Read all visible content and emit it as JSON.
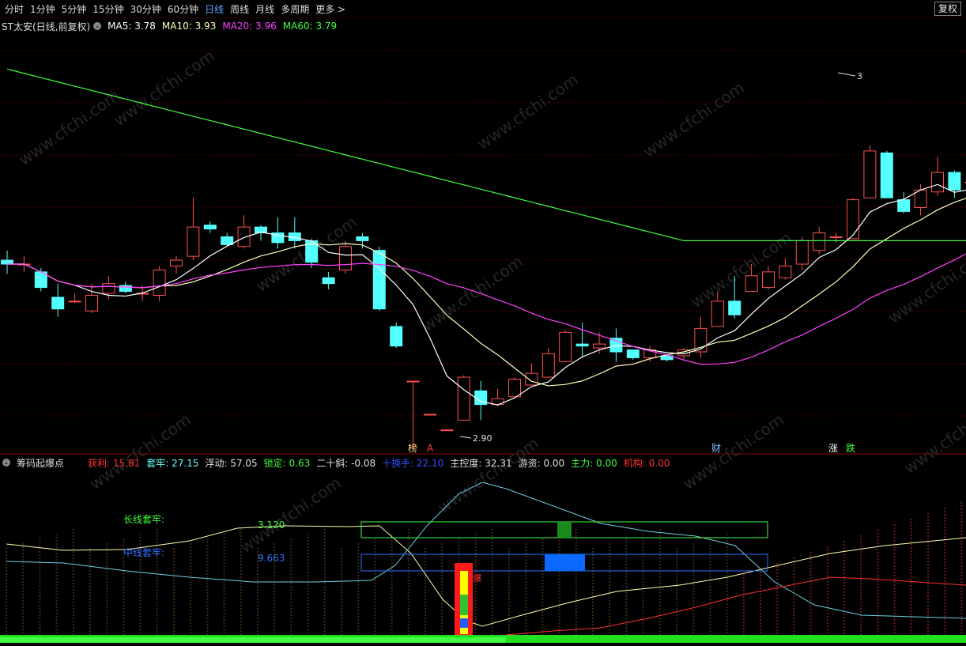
{
  "toolbar": {
    "periods": [
      "分时",
      "1分钟",
      "5分钟",
      "15分钟",
      "30分钟",
      "60分钟",
      "日线",
      "周线",
      "月线",
      "多周期",
      "更多 >"
    ],
    "active": "日线",
    "adjust": "复权"
  },
  "main_header": {
    "title": "ST太安(日线,前复权)",
    "ma5": "MA5: 3.78",
    "ma10": "MA10: 3.93",
    "ma20": "MA20: 3.96",
    "ma60": "MA60: 3.79",
    "colors": {
      "ma5": "#ffffff",
      "ma10": "#ffffc0",
      "ma20": "#ff40ff",
      "ma60": "#40ff40"
    }
  },
  "annotations": {
    "high_label": "3",
    "low_label": "2.90",
    "marks": [
      {
        "text": "榜",
        "color": "#ffd080"
      },
      {
        "text": "A",
        "color": "#ff4040"
      },
      {
        "text": "财",
        "color": "#80c0ff"
      },
      {
        "text": "涨",
        "color": "#ffffff"
      },
      {
        "text": "跌",
        "color": "#40ff40"
      }
    ]
  },
  "sub_header": {
    "title": "筹码起爆点",
    "items": [
      {
        "text": "获利: 15.81",
        "color": "#ff3030"
      },
      {
        "text": "套牢: 27.15",
        "color": "#66ffff"
      },
      {
        "text": "浮动: 57.05",
        "color": "#e0e0e0"
      },
      {
        "text": "锁定: 0.63",
        "color": "#40ff40"
      },
      {
        "text": "二十斜: -0.08",
        "color": "#e0e0e0"
      },
      {
        "text": "十换手: 22.10",
        "color": "#3050ff"
      },
      {
        "text": "主控度: 32.31",
        "color": "#e0e0e0"
      },
      {
        "text": "游资: 0.00",
        "color": "#e0e0e0"
      },
      {
        "text": "主力: 0.00",
        "color": "#40ff40"
      },
      {
        "text": "机构: 0.00",
        "color": "#ff3030"
      }
    ]
  },
  "indicator": {
    "long_label": "长线套牢:",
    "long_value": "3.120",
    "mid_label": "中线套牢:",
    "mid_value": "9.663",
    "burst_label": "爆"
  },
  "watermark": "www.cfchi.com",
  "chart_data": {
    "type": "candlestick",
    "ylim": [
      2.8,
      4.9
    ],
    "candles": [
      [
        3.72,
        3.7,
        3.77,
        3.65
      ],
      [
        3.7,
        3.7,
        3.74,
        3.66
      ],
      [
        3.66,
        3.58,
        3.68,
        3.56
      ],
      [
        3.53,
        3.47,
        3.6,
        3.43
      ],
      [
        3.51,
        3.51,
        3.55,
        3.5
      ],
      [
        3.46,
        3.54,
        3.6,
        3.45
      ],
      [
        3.55,
        3.6,
        3.64,
        3.52
      ],
      [
        3.59,
        3.56,
        3.61,
        3.55
      ],
      [
        3.55,
        3.55,
        3.59,
        3.51
      ],
      [
        3.54,
        3.67,
        3.69,
        3.51
      ],
      [
        3.69,
        3.72,
        3.74,
        3.65
      ],
      [
        3.74,
        3.89,
        4.04,
        3.72
      ],
      [
        3.9,
        3.88,
        3.92,
        3.86
      ],
      [
        3.84,
        3.8,
        3.86,
        3.79
      ],
      [
        3.79,
        3.89,
        3.95,
        3.78
      ],
      [
        3.89,
        3.86,
        3.9,
        3.82
      ],
      [
        3.86,
        3.81,
        3.94,
        3.78
      ],
      [
        3.86,
        3.82,
        3.94,
        3.78
      ],
      [
        3.82,
        3.71,
        3.83,
        3.68
      ],
      [
        3.63,
        3.6,
        3.66,
        3.57
      ],
      [
        3.67,
        3.79,
        3.82,
        3.65
      ],
      [
        3.84,
        3.82,
        3.86,
        3.78
      ],
      [
        3.77,
        3.47,
        3.79,
        3.46
      ],
      [
        3.38,
        3.28,
        3.4,
        3.27
      ],
      [
        3.1,
        3.1,
        3.1,
        2.75
      ],
      [
        2.93,
        2.93,
        2.93,
        2.93
      ],
      [
        2.85,
        2.85,
        2.85,
        2.85
      ],
      [
        2.9,
        3.12,
        3.13,
        2.9
      ],
      [
        3.05,
        2.98,
        3.1,
        2.9
      ],
      [
        2.98,
        3.01,
        3.06,
        2.97
      ],
      [
        3.02,
        3.11,
        3.12,
        3.02
      ],
      [
        3.08,
        3.14,
        3.19,
        3.08
      ],
      [
        3.12,
        3.24,
        3.27,
        3.12
      ],
      [
        3.2,
        3.35,
        3.36,
        3.2
      ],
      [
        3.29,
        3.28,
        3.4,
        3.22
      ],
      [
        3.27,
        3.29,
        3.35,
        3.24
      ],
      [
        3.32,
        3.25,
        3.37,
        3.2
      ],
      [
        3.26,
        3.22,
        3.26,
        3.21
      ],
      [
        3.22,
        3.26,
        3.28,
        3.2
      ],
      [
        3.23,
        3.21,
        3.24,
        3.2
      ],
      [
        3.23,
        3.26,
        3.27,
        3.21
      ],
      [
        3.25,
        3.37,
        3.43,
        3.22
      ],
      [
        3.38,
        3.51,
        3.56,
        3.38
      ],
      [
        3.51,
        3.44,
        3.64,
        3.42
      ],
      [
        3.56,
        3.64,
        3.7,
        3.56
      ],
      [
        3.58,
        3.66,
        3.69,
        3.57
      ],
      [
        3.63,
        3.69,
        3.73,
        3.62
      ],
      [
        3.7,
        3.82,
        3.84,
        3.67
      ],
      [
        3.77,
        3.86,
        3.89,
        3.75
      ],
      [
        3.84,
        3.84,
        3.86,
        3.81
      ],
      [
        3.83,
        4.03,
        4.04,
        3.83
      ],
      [
        4.04,
        4.28,
        4.31,
        4.04
      ],
      [
        4.27,
        4.04,
        4.28,
        4.04
      ],
      [
        4.03,
        3.97,
        4.07,
        3.96
      ],
      [
        3.99,
        4.08,
        4.11,
        3.95
      ],
      [
        4.07,
        4.17,
        4.25,
        4.05
      ],
      [
        4.17,
        4.08,
        4.18,
        4.04
      ],
      [
        4.12,
        4.12,
        4.15,
        4.1
      ],
      [
        4.12,
        3.99,
        4.13,
        3.96
      ]
    ]
  }
}
